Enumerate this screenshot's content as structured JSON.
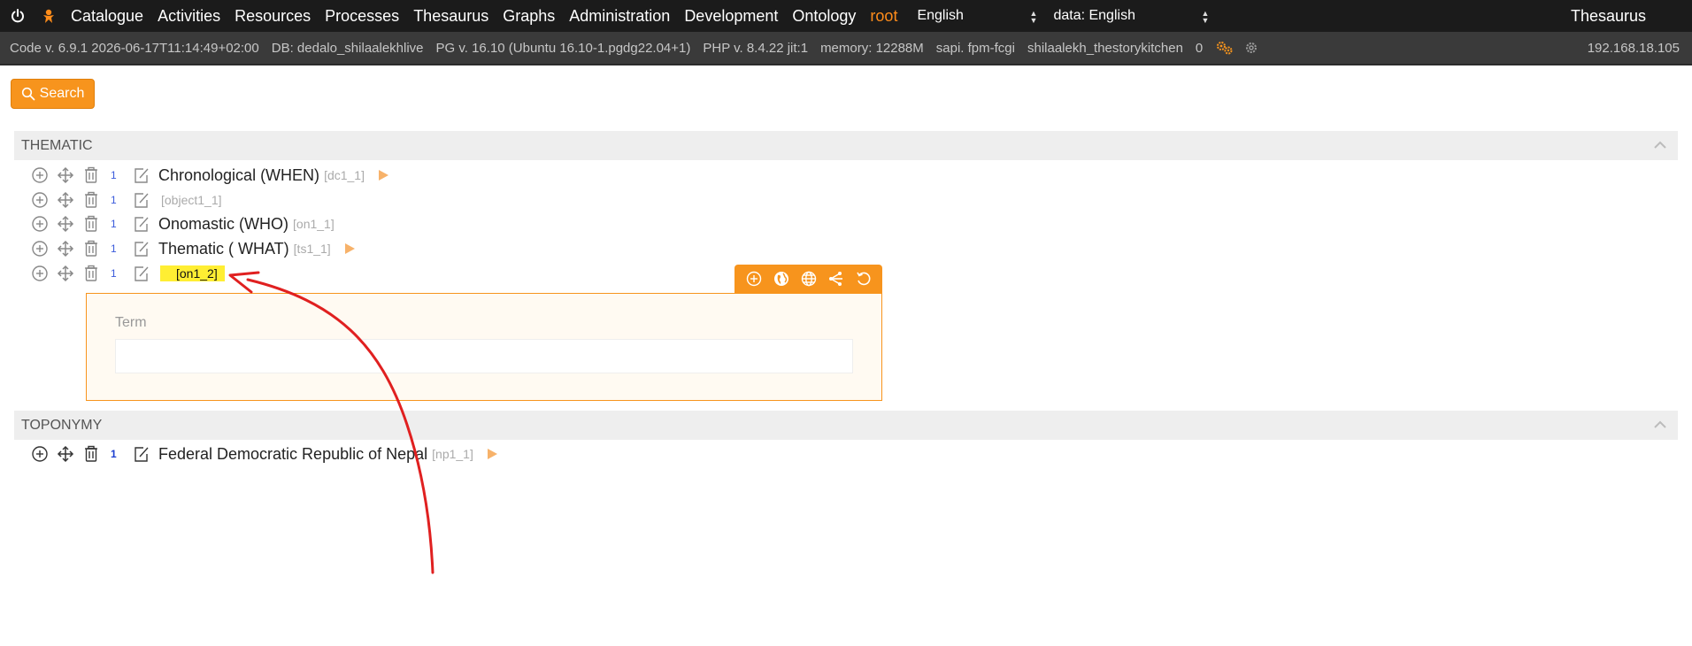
{
  "menu": {
    "items": [
      "Catalogue",
      "Activities",
      "Resources",
      "Processes",
      "Thesaurus",
      "Graphs",
      "Administration",
      "Development",
      "Ontology"
    ],
    "user": "root",
    "lang_select": "English",
    "data_lang_select": "data: English",
    "page_title": "Thesaurus"
  },
  "info": {
    "code_version": "Code v. 6.9.1 2026-06-17T11:14:49+02:00",
    "db": "DB: dedalo_shilaalekhlive",
    "pg": "PG v. 16.10 (Ubuntu 16.10-1.pgdg22.04+1)",
    "php": "PHP v. 8.4.22 jit:1",
    "memory": "memory: 12288M",
    "sapi": "sapi. fpm-fcgi",
    "user": "shilaalekh_thestorykitchen",
    "count": "0",
    "ip": "192.168.18.105"
  },
  "search": {
    "label": "Search"
  },
  "sections": [
    {
      "title": "THEMATIC",
      "rows": [
        {
          "order": "1",
          "term": "Chronological (WHEN)",
          "code": "[dc1_1]",
          "has_children": true
        },
        {
          "order": "1",
          "term": "",
          "code": "[object1_1]",
          "has_children": false
        },
        {
          "order": "1",
          "term": "Onomastic (WHO)",
          "code": "[on1_1]",
          "has_children": false
        },
        {
          "order": "1",
          "term": "Thematic ( WHAT)",
          "code": "[ts1_1]",
          "has_children": true
        },
        {
          "order": "1",
          "term": "",
          "code": "[on1_2]",
          "has_children": false
        }
      ]
    },
    {
      "title": "TOPONYMY",
      "rows": [
        {
          "order": "1",
          "term": "Federal Democratic Republic of Nepal",
          "code": "[np1_1]",
          "has_children": true
        }
      ]
    }
  ],
  "edit_panel": {
    "label": "Term",
    "value": "",
    "placeholder": ""
  },
  "colors": {
    "accent": "#f7941d",
    "menubar": "#1b1b1b",
    "infobar": "#3a3a3a",
    "highlight": "#ffee33",
    "annotation": "#e02020"
  }
}
